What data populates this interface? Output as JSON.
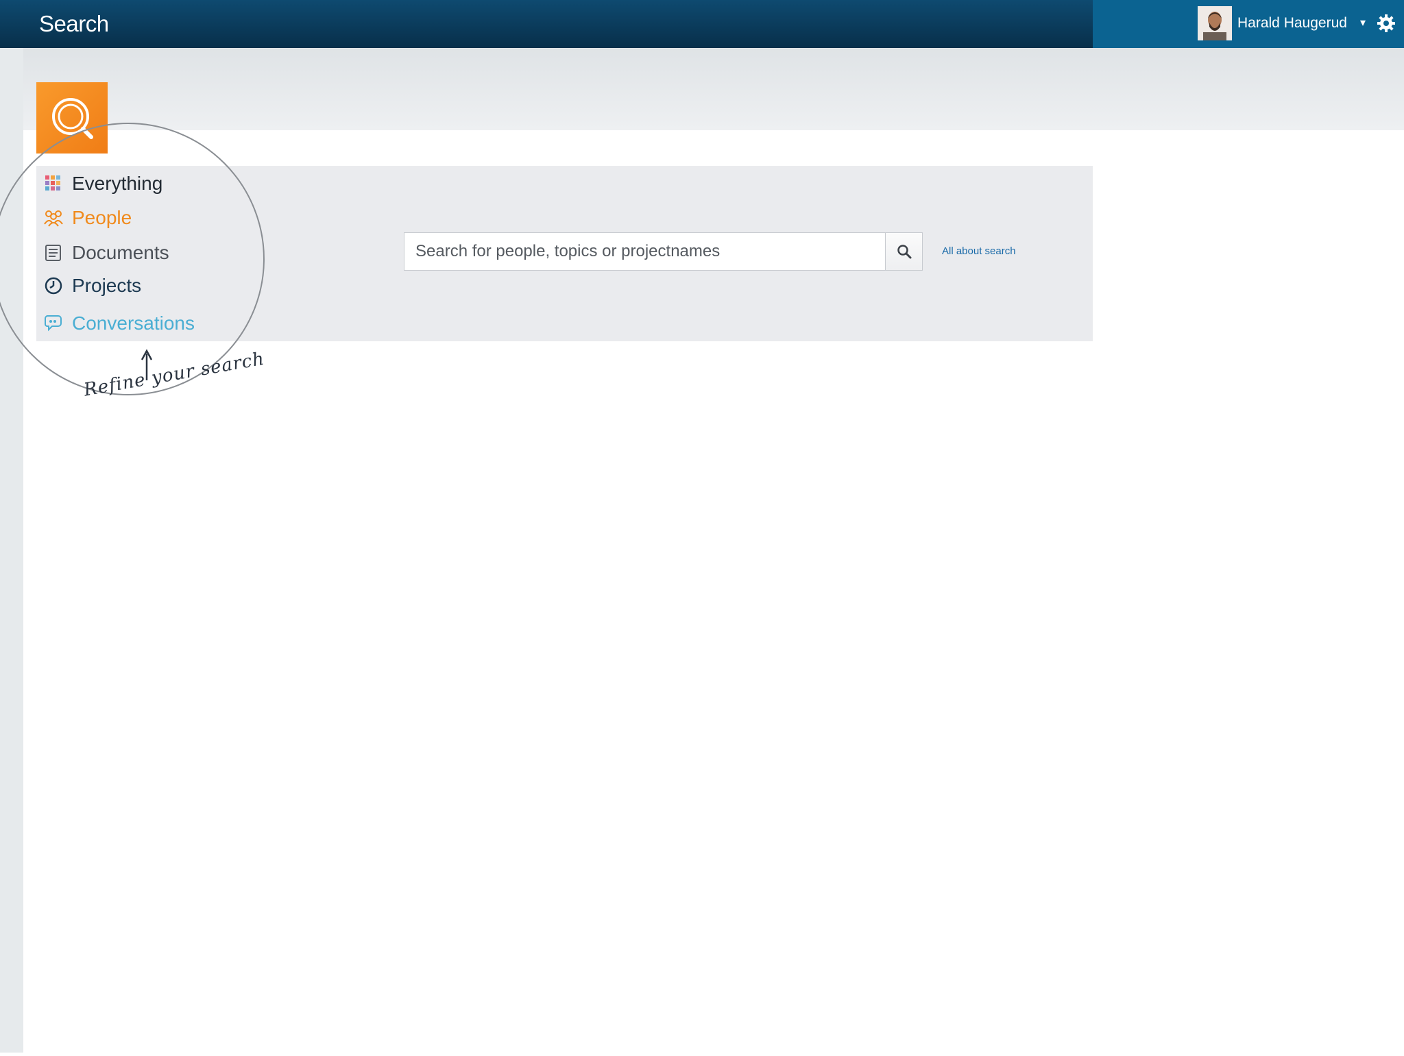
{
  "topbar": {
    "title": "Search",
    "user_name": "Harald Haugerud",
    "caret": "▾"
  },
  "logo": {
    "icon": "search-icon",
    "color": "#f5871e"
  },
  "categories": [
    {
      "label": "Everything",
      "icon": "grid-icon",
      "color": "#222a33"
    },
    {
      "label": "People",
      "icon": "people-icon",
      "color": "#f08a1c"
    },
    {
      "label": "Documents",
      "icon": "document-icon",
      "color": "#4b5057"
    },
    {
      "label": "Projects",
      "icon": "clock-icon",
      "color": "#1d3a52"
    },
    {
      "label": "Conversations",
      "icon": "conversation-icon",
      "color": "#4aaed3"
    }
  ],
  "search": {
    "placeholder": "Search for people, topics or projectnames",
    "button_icon": "magnifier-icon",
    "about_link": "All about search"
  },
  "annotation": {
    "text": "Refine your search"
  },
  "colors": {
    "topbar": "#0a3a5a",
    "user_area": "#0b6391",
    "panel": "#eaebee",
    "accent": "#f5871e"
  }
}
